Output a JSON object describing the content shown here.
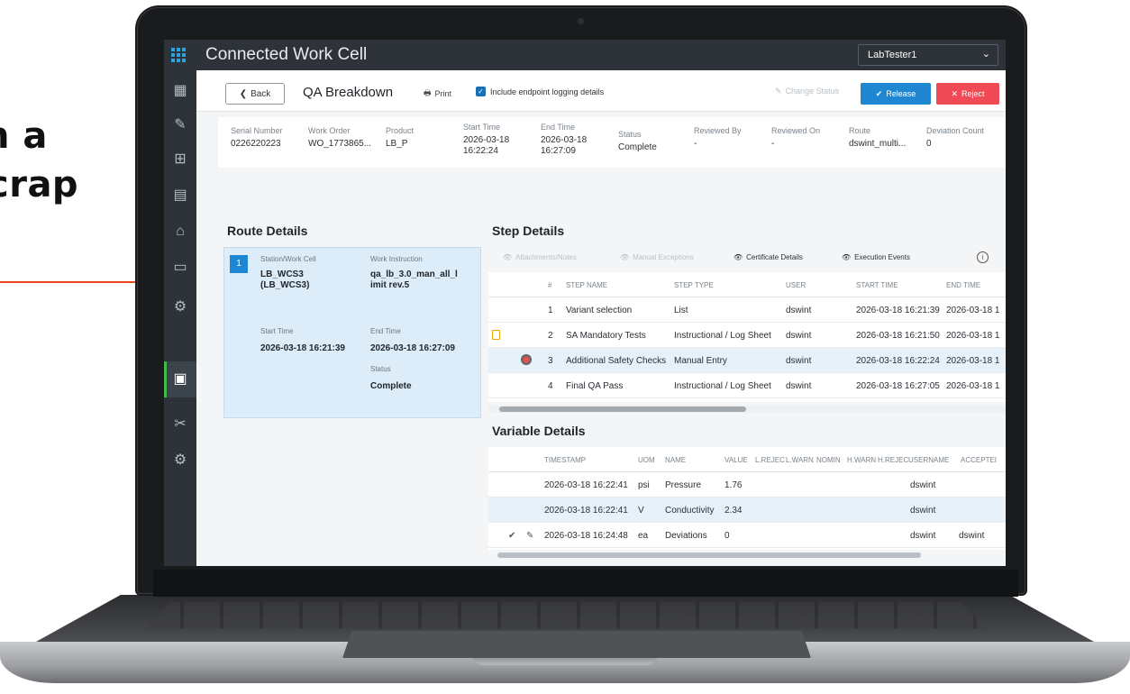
{
  "promo": {
    "line1": "n a",
    "line2": "crap"
  },
  "app": {
    "title": "Connected Work Cell",
    "user": "LabTester1"
  },
  "sidebar": {
    "icons": [
      "dashboard-icon",
      "pencil-icon",
      "flow-icon",
      "schedule-icon",
      "workstation-icon",
      "monitor-icon",
      "robot-icon",
      "report-icon",
      "tools-icon",
      "settings-icon"
    ],
    "active": "report-icon"
  },
  "toolbar": {
    "back_label": "Back",
    "title": "QA Breakdown",
    "print_label": "Print",
    "include_logging_label": "Include endpoint logging details",
    "include_logging_checked": true,
    "change_status_label": "Change Status",
    "release_label": "Release",
    "reject_label": "Reject"
  },
  "summary": {
    "serial_number": {
      "label": "Serial Number",
      "value": "0226220223"
    },
    "work_order": {
      "label": "Work Order",
      "value": "WO_1773865..."
    },
    "product": {
      "label": "Product",
      "value": "LB_P"
    },
    "start_time": {
      "label": "Start Time",
      "value": "2026-03-18 16:22:24"
    },
    "end_time": {
      "label": "End Time",
      "value": "2026-03-18 16:27:09"
    },
    "status": {
      "label": "Status",
      "value": "Complete"
    },
    "reviewed_by": {
      "label": "Reviewed By",
      "value": "-"
    },
    "reviewed_on": {
      "label": "Reviewed On",
      "value": "-"
    },
    "route": {
      "label": "Route",
      "value": "dswint_multi..."
    },
    "deviation_count": {
      "label": "Deviation Count",
      "value": "0"
    }
  },
  "route_details": {
    "title": "Route Details",
    "card": {
      "number": "1",
      "station_label": "Station/Work Cell",
      "station_value_1": "LB_WCS3",
      "station_value_2": "(LB_WCS3)",
      "instruction_label": "Work Instruction",
      "instruction_value_1": "qa_lb_3.0_man_all_l",
      "instruction_value_2": "imit rev.5",
      "start_label": "Start Time",
      "start_value": "2026-03-18 16:21:39",
      "end_label": "End Time",
      "end_value": "2026-03-18 16:27:09",
      "status_label": "Status",
      "status_value": "Complete"
    }
  },
  "step_details": {
    "title": "Step Details",
    "tabs": [
      {
        "label": "Attachments/Notes",
        "enabled": false
      },
      {
        "label": "Manual Exceptions",
        "enabled": false
      },
      {
        "label": "Certificate Details",
        "enabled": true
      },
      {
        "label": "Execution Events",
        "enabled": true
      }
    ],
    "columns": [
      "#",
      "STEP NAME",
      "STEP TYPE",
      "USER",
      "START TIME",
      "END TIME"
    ],
    "rows": [
      {
        "num": "1",
        "name": "Variant selection",
        "type": "List",
        "user": "dswint",
        "start": "2026-03-18 16:21:39",
        "end": "2026-03-18 1"
      },
      {
        "num": "2",
        "name": "SA Mandatory Tests",
        "type": "Instructional / Log Sheet",
        "user": "dswint",
        "start": "2026-03-18 16:21:50",
        "end": "2026-03-18 1",
        "icon": "clipboard-icon"
      },
      {
        "num": "3",
        "name": "Additional Safety Checks",
        "type": "Manual Entry",
        "user": "dswint",
        "start": "2026-03-18 16:22:24",
        "end": "2026-03-18 1",
        "icon": "exception-icon",
        "selected": true
      },
      {
        "num": "4",
        "name": "Final QA Pass",
        "type": "Instructional / Log Sheet",
        "user": "dswint",
        "start": "2026-03-18 16:27:05",
        "end": "2026-03-18 1"
      }
    ]
  },
  "variable_details": {
    "title": "Variable Details",
    "columns": [
      "TIMESTAMP",
      "UOM",
      "NAME",
      "VALUE",
      "L.REJEC",
      "L.WARN",
      "NOMIN",
      "H.WARN",
      "H.REJEC",
      "USERNAME",
      "ACCEPTEI"
    ],
    "rows": [
      {
        "timestamp": "2026-03-18 16:22:41",
        "uom": "psi",
        "name": "Pressure",
        "value": "1.76",
        "username": "dswint",
        "accepted": ""
      },
      {
        "timestamp": "2026-03-18 16:22:41",
        "uom": "V",
        "name": "Conductivity",
        "value": "2.34",
        "username": "dswint",
        "accepted": "",
        "selected": true
      },
      {
        "timestamp": "2026-03-18 16:24:48",
        "uom": "ea",
        "name": "Deviations",
        "value": "0",
        "username": "dswint",
        "accepted": "dswint",
        "icons": [
          "check-icon",
          "edit-icon"
        ]
      }
    ]
  }
}
